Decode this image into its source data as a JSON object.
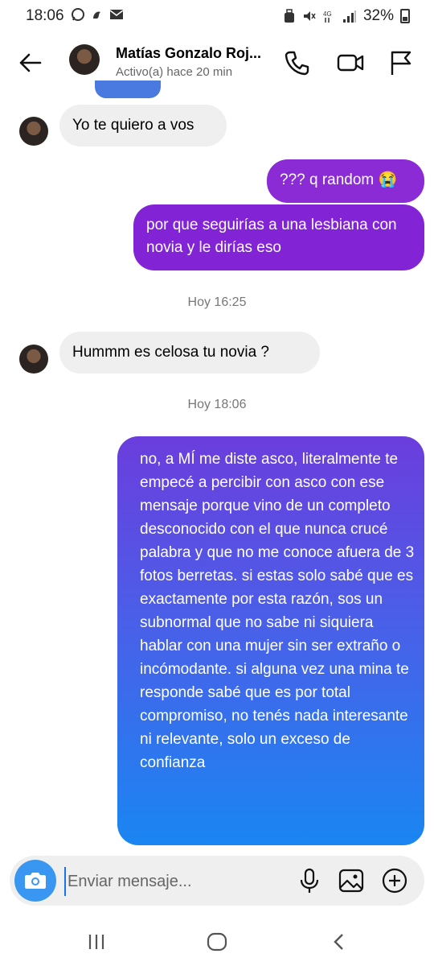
{
  "status_bar": {
    "time": "18:06",
    "battery": "32%"
  },
  "header": {
    "name": "Matías Gonzalo Roj...",
    "status": "Activo(a) hace 20 min"
  },
  "messages": [
    {
      "text": "Yo te quiero a vos",
      "sender": "them"
    },
    {
      "text": "??? q random 😭",
      "sender": "me"
    },
    {
      "text": "por que seguirías a una lesbiana con novia y le dirías eso",
      "sender": "me"
    },
    {
      "text": "Hummm es celosa tu novia ?",
      "sender": "them"
    },
    {
      "text": "no, a MÍ me diste asco, literalmente te empecé a percibir con asco con ese mensaje porque vino de un completo desconocido con el que nunca crucé palabra y que no me conoce afuera de 3 fotos berretas. si estas solo sabé que es exactamente por esta razón, sos un subnormal que no sabe ni siquiera hablar con una mujer sin ser extraño o incómodante. si alguna vez una mina te responde sabé que es por total compromiso, no tenés nada interesante ni relevante, solo un exceso de confianza",
      "sender": "me"
    }
  ],
  "timestamps": [
    "Hoy 16:25",
    "Hoy 18:06"
  ],
  "composer": {
    "placeholder": "Enviar mensaje..."
  },
  "colors": {
    "incoming_bubble": "#efefef",
    "outgoing_purple": "#8a2bd6",
    "outgoing_blue": "#1a86f2",
    "camera_button": "#3a97f1"
  }
}
